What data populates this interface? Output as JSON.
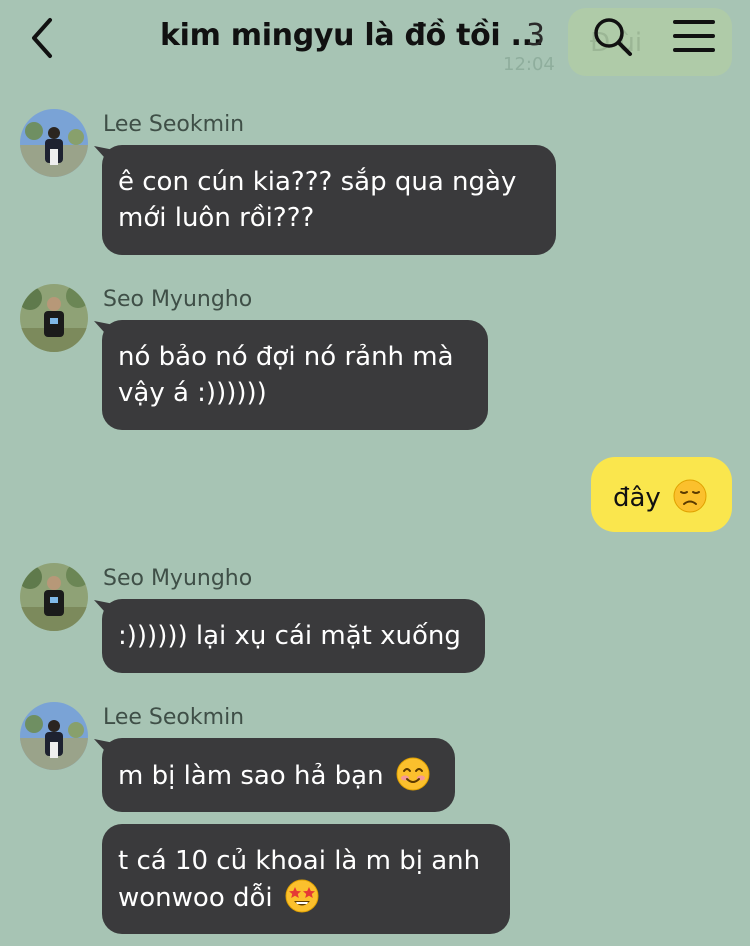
{
  "header": {
    "title": "kim mingyu là đồ tồi ...",
    "member_count": "3",
    "ghost_preview": "Đ    ùi",
    "ghost_time": "12:04"
  },
  "messages": [
    {
      "sender": "Lee Seokmin",
      "lines": [
        "ê con cún kia??? sắp qua ngày",
        "mới luôn rồi???"
      ]
    },
    {
      "sender": "Seo Myungho",
      "lines": [
        "nó bảo nó đợi nó rảnh mà",
        "vậy á :))))))"
      ]
    },
    {
      "mine": true,
      "text": "đây",
      "emoji": "disappointed-face"
    },
    {
      "sender": "Seo Myungho",
      "lines": [
        ":)))))) lại xụ cái mặt xuống"
      ]
    },
    {
      "sender": "Lee Seokmin",
      "lines": [
        "m bị làm sao hả bạn"
      ],
      "emoji": "smiling-face"
    },
    {
      "lines": [
        "t cá 10 củ khoai là m bị anh",
        "wonwoo dỗi"
      ],
      "emoji": "star-struck-face"
    }
  ],
  "colors": {
    "background": "#a7c4b4",
    "incoming_bubble": "#3a3a3c",
    "outgoing_bubble": "#fae64d"
  }
}
